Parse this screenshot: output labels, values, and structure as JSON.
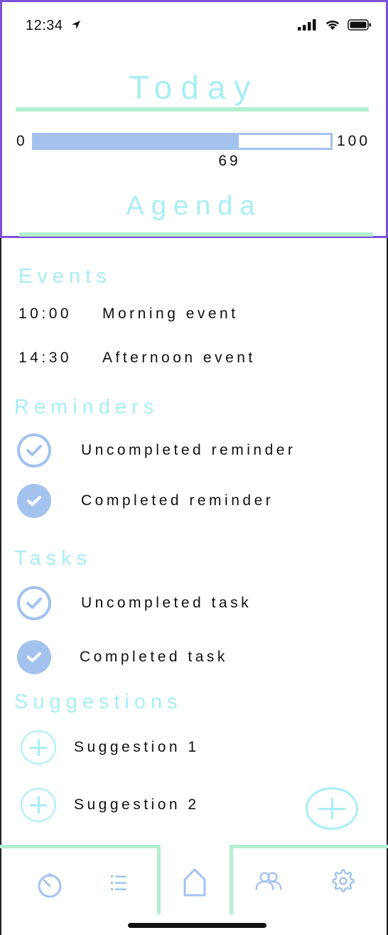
{
  "status_bar": {
    "time": "12:34"
  },
  "header": {
    "title": "Today",
    "progress": {
      "min": "0",
      "max": "100",
      "value": 69,
      "value_label": "69"
    },
    "agenda_title": "Agenda"
  },
  "events": {
    "title": "Events",
    "items": [
      {
        "time": "10:00",
        "label": "Morning event"
      },
      {
        "time": "14:30",
        "label": "Afternoon event"
      }
    ]
  },
  "reminders": {
    "title": "Reminders",
    "items": [
      {
        "label": "Uncompleted reminder",
        "completed": false
      },
      {
        "label": "Completed reminder",
        "completed": true
      }
    ]
  },
  "tasks": {
    "title": "Tasks",
    "items": [
      {
        "label": "Uncompleted task",
        "completed": false
      },
      {
        "label": "Completed task",
        "completed": true
      }
    ]
  },
  "suggestions": {
    "title": "Suggestions",
    "items": [
      {
        "label": "Suggestion 1"
      },
      {
        "label": "Suggestion 2"
      }
    ]
  },
  "tabbar": {
    "tabs": [
      {
        "icon": "timer-icon"
      },
      {
        "icon": "list-icon"
      },
      {
        "icon": "home-icon",
        "selected": true
      },
      {
        "icon": "people-icon"
      },
      {
        "icon": "gear-icon"
      }
    ]
  },
  "colors": {
    "accent_cyan": "#a8eef6",
    "accent_blue": "#a3c3ee",
    "rule_green": "#b3efd1",
    "header_border": "#7b52d6"
  }
}
